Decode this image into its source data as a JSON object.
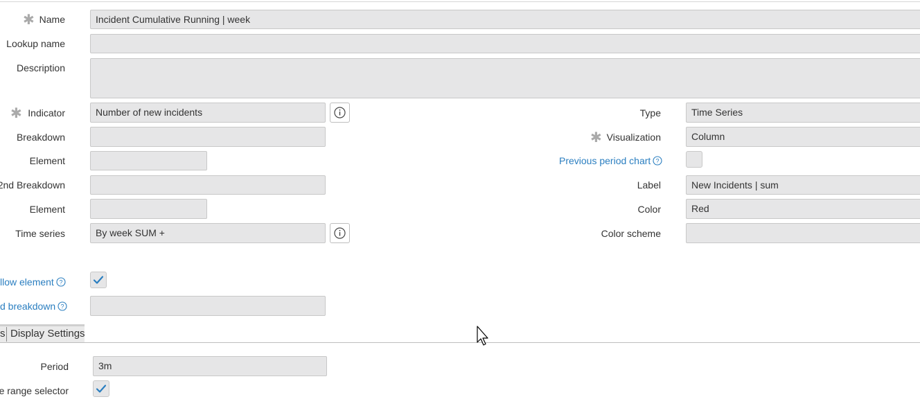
{
  "form": {
    "name": {
      "label": "Name",
      "value": "Incident Cumulative Running | week"
    },
    "lookup_name": {
      "label": "Lookup name",
      "value": ""
    },
    "description": {
      "label": "Description",
      "value": ""
    },
    "indicator": {
      "label": "Indicator",
      "value": "Number of new incidents"
    },
    "breakdown": {
      "label": "Breakdown",
      "value": ""
    },
    "element": {
      "label": "Element",
      "value": ""
    },
    "breakdown2": {
      "label": "2nd Breakdown",
      "value": ""
    },
    "element2": {
      "label": "Element",
      "value": ""
    },
    "time_series": {
      "label": "Time series",
      "value": "By week SUM +"
    },
    "type": {
      "label": "Type",
      "value": "Time Series"
    },
    "visualization": {
      "label": "Visualization",
      "value": "Column"
    },
    "previous_period_chart": {
      "label": "Previous period chart",
      "checked": false
    },
    "chart_label": {
      "label": "Label",
      "value": "New Incidents | sum"
    },
    "color": {
      "label": "Color",
      "value": "Red"
    },
    "color_scheme": {
      "label": "Color scheme",
      "value": ""
    },
    "follow_element": {
      "label": "llow element",
      "checked": true
    },
    "follow_breakdown": {
      "label": "d breakdown",
      "value": ""
    }
  },
  "tabs": {
    "left_partial": "s",
    "display_settings": "Display Settings"
  },
  "display": {
    "period": {
      "label": "Period",
      "value": "3m"
    },
    "date_range_selector": {
      "label": "te range selector",
      "checked": true
    }
  },
  "colors": {
    "accent": "#2a7ec0",
    "field_bg": "#e6e6e7",
    "required": "#aaaaaa"
  },
  "icons": {
    "required": "asterisk-icon",
    "info": "info-icon",
    "help": "question-circle-icon",
    "check": "check-icon",
    "cursor": "mouse-pointer-icon"
  }
}
